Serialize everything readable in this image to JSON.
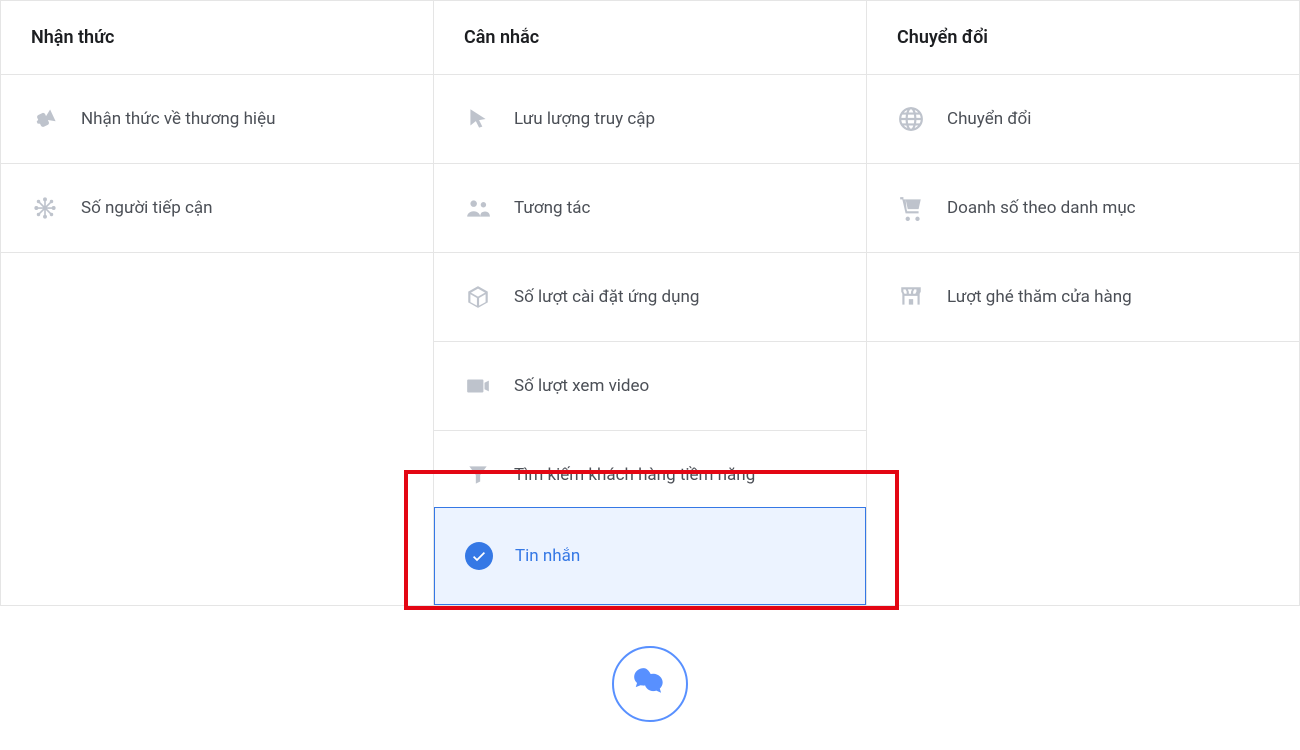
{
  "columns": {
    "awareness": {
      "header": "Nhận thức",
      "items": [
        {
          "label": "Nhận thức về thương hiệu",
          "icon": "megaphone"
        },
        {
          "label": "Số người tiếp cận",
          "icon": "reach"
        }
      ]
    },
    "consideration": {
      "header": "Cân nhắc",
      "items": [
        {
          "label": "Lưu lượng truy cập",
          "icon": "cursor"
        },
        {
          "label": "Tương tác",
          "icon": "people"
        },
        {
          "label": "Số lượt cài đặt ứng dụng",
          "icon": "box"
        },
        {
          "label": "Số lượt xem video",
          "icon": "video"
        },
        {
          "label": "Tìm kiếm khách hàng tiềm năng",
          "icon": "funnel"
        },
        {
          "label": "Tin nhắn",
          "icon": "check",
          "selected": true
        }
      ]
    },
    "conversion": {
      "header": "Chuyển đổi",
      "items": [
        {
          "label": "Chuyển đổi",
          "icon": "globe"
        },
        {
          "label": "Doanh số theo danh mục",
          "icon": "cart"
        },
        {
          "label": "Lượt ghé thăm cửa hàng",
          "icon": "store"
        }
      ]
    }
  }
}
